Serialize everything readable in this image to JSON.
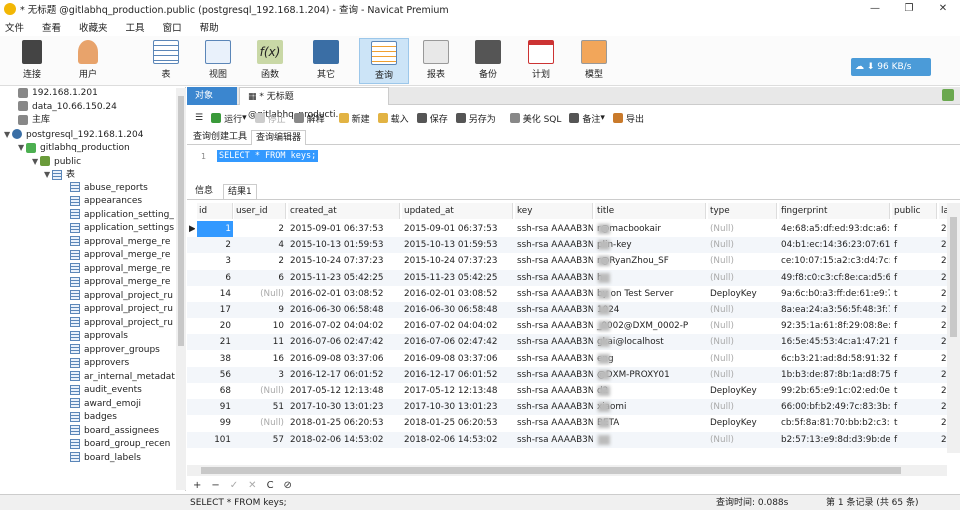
{
  "window": {
    "title": "* 无标题 @gitlabhq_production.public (postgresql_192.168.1.204) - 查询 - Navicat Premium",
    "controls": [
      "—",
      "❐",
      "✕"
    ]
  },
  "menu": [
    "文件",
    "查看",
    "收藏夹",
    "工具",
    "窗口",
    "帮助"
  ],
  "toolbar": {
    "buttons": [
      {
        "label": "连接",
        "icon": "connection-icon"
      },
      {
        "label": "用户",
        "icon": "user-icon"
      },
      {
        "label": "表",
        "icon": "table-icon"
      },
      {
        "label": "视图",
        "icon": "view-icon"
      },
      {
        "label": "函数",
        "icon": "function-icon"
      },
      {
        "label": "其它",
        "icon": "other-icon"
      },
      {
        "label": "查询",
        "icon": "query-icon",
        "active": true
      },
      {
        "label": "报表",
        "icon": "report-icon"
      },
      {
        "label": "备份",
        "icon": "backup-icon"
      },
      {
        "label": "计划",
        "icon": "schedule-icon"
      },
      {
        "label": "模型",
        "icon": "model-icon"
      }
    ],
    "speed": "96 KB/s"
  },
  "tree": {
    "connections": [
      "192.168.1.201",
      "data_10.66.150.24",
      "主库",
      "postgresql_192.168.1.204"
    ],
    "database": "gitlabhq_production",
    "schema": "public",
    "tables_node": "表",
    "tables": [
      "abuse_reports",
      "appearances",
      "application_setting_",
      "application_settings",
      "approval_merge_re",
      "approval_merge_re",
      "approval_merge_re",
      "approval_merge_re",
      "approval_project_ru",
      "approval_project_ru",
      "approval_project_ru",
      "approvals",
      "approver_groups",
      "approvers",
      "ar_internal_metadat",
      "audit_events",
      "award_emoji",
      "badges",
      "board_assignees",
      "board_group_recen",
      "board_labels"
    ]
  },
  "tabs": {
    "object": "对象",
    "query": "* 无标题 @gitlabhq_producti..."
  },
  "query_toolbar": [
    "运行",
    "停止",
    "解释",
    "新建",
    "载入",
    "保存",
    "另存为",
    "美化 SQL",
    "备注",
    "导出"
  ],
  "sub_tabs": [
    "查询创建工具",
    "查询编辑器"
  ],
  "editor": {
    "line": "1",
    "sql": "SELECT * FROM keys;"
  },
  "result_tabs": [
    "信息",
    "结果1"
  ],
  "grid": {
    "columns": [
      "id",
      "user_id",
      "created_at",
      "updated_at",
      "key",
      "title",
      "type",
      "fingerprint",
      "public",
      "la"
    ],
    "rows": [
      [
        "1",
        "2",
        "2015-09-01 06:37:53",
        "2015-09-01 06:37:53",
        "ssh-rsa AAAAB3N",
        "r@macbookair",
        "(Null)",
        "4e:68:a5:df:ed:93:dc:a6:5b",
        "f",
        "2"
      ],
      [
        "2",
        "4",
        "2015-10-13 01:59:53",
        "2015-10-13 01:59:53",
        "ssh-rsa AAAAB3N",
        "plin-key",
        "(Null)",
        "04:b1:ec:14:36:23:07:61:5f",
        "f",
        "2"
      ],
      [
        "3",
        "2",
        "2015-10-24 07:37:23",
        "2015-10-24 07:37:23",
        "ssh-rsa AAAAB3N",
        "r@RyanZhou_SF",
        "(Null)",
        "ce:10:07:15:a2:c3:d4:7c:30",
        "f",
        "2"
      ],
      [
        "6",
        "6",
        "2015-11-23 05:42:25",
        "2015-11-23 05:42:25",
        "ssh-rsa AAAAB3N",
        "h",
        "(Null)",
        "49:f8:c0:c3:cf:8e:ca:d5:66:5",
        "f",
        "2"
      ],
      [
        "14",
        "(Null)",
        "2016-02-01 03:08:52",
        "2016-02-01 03:08:52",
        "ssh-rsa AAAAB3N",
        "by on Test Server",
        "DeployKey",
        "9a:6c:b0:a3:ff:de:61:e9:78:",
        "t",
        "2"
      ],
      [
        "17",
        "9",
        "2016-06-30 06:58:48",
        "2016-06-30 06:58:48",
        "ssh-rsa AAAAB3N",
        "1024",
        "(Null)",
        "8a:ea:24:a3:56:5f:48:3f:7d:",
        "f",
        "2"
      ],
      [
        "20",
        "10",
        "2016-07-02 04:04:02",
        "2016-07-02 04:04:02",
        "ssh-rsa AAAAB3N",
        "_0002@DXM_0002-P",
        "(Null)",
        "92:35:1a:61:8f:29:08:8e:e3",
        "f",
        "2"
      ],
      [
        "21",
        "11",
        "2016-07-06 02:47:42",
        "2016-07-06 02:47:42",
        "ssh-rsa AAAAB3N",
        "gkai@localhost",
        "(Null)",
        "16:5e:45:53:4c:a1:47:21:f6:",
        "f",
        "2"
      ],
      [
        "38",
        "16",
        "2016-09-08 03:37:06",
        "2016-09-08 03:37:06",
        "ssh-rsa AAAAB3N",
        "eng",
        "(Null)",
        "6c:b3:21:ad:8d:58:91:32:ec",
        "f",
        "2"
      ],
      [
        "56",
        "3",
        "2016-12-17 06:01:52",
        "2016-12-17 06:01:52",
        "ssh-rsa AAAAB3N",
        "@DXM-PROXY01",
        "(Null)",
        "1b:b3:de:87:8b:1a:d8:75:2",
        "f",
        "2"
      ],
      [
        "68",
        "(Null)",
        "2017-05-12 12:13:48",
        "2017-05-12 12:13:48",
        "ssh-rsa AAAAB3N",
        "d2",
        "DeployKey",
        "99:2b:65:e9:1c:02:ed:0e:d",
        "t",
        "2"
      ],
      [
        "91",
        "51",
        "2017-10-30 13:01:23",
        "2017-10-30 13:01:23",
        "ssh-rsa AAAAB3N",
        "xiaomi",
        "(Null)",
        "66:00:bf:b2:49:7c:83:3b:c8",
        "f",
        "2"
      ],
      [
        "99",
        "(Null)",
        "2018-01-25 06:20:53",
        "2018-01-25 06:20:53",
        "ssh-rsa AAAAB3N",
        "BETA",
        "DeployKey",
        "cb:5f:8a:81:70:bb:b2:c3:15",
        "t",
        "2"
      ],
      [
        "101",
        "57",
        "2018-02-06 14:53:02",
        "2018-02-06 14:53:02",
        "ssh-rsa AAAAB3N",
        "",
        "(Null)",
        "b2:57:13:e9:8d:d3:9b:de:e",
        "f",
        "2"
      ]
    ]
  },
  "navbar": [
    "+",
    "−",
    "✓",
    "✕",
    "C",
    "⊘"
  ],
  "status": {
    "sql": "SELECT * FROM keys;",
    "query_time": "查询时间: 0.088s",
    "records": "第 1 条记录 (共 65 条)"
  }
}
